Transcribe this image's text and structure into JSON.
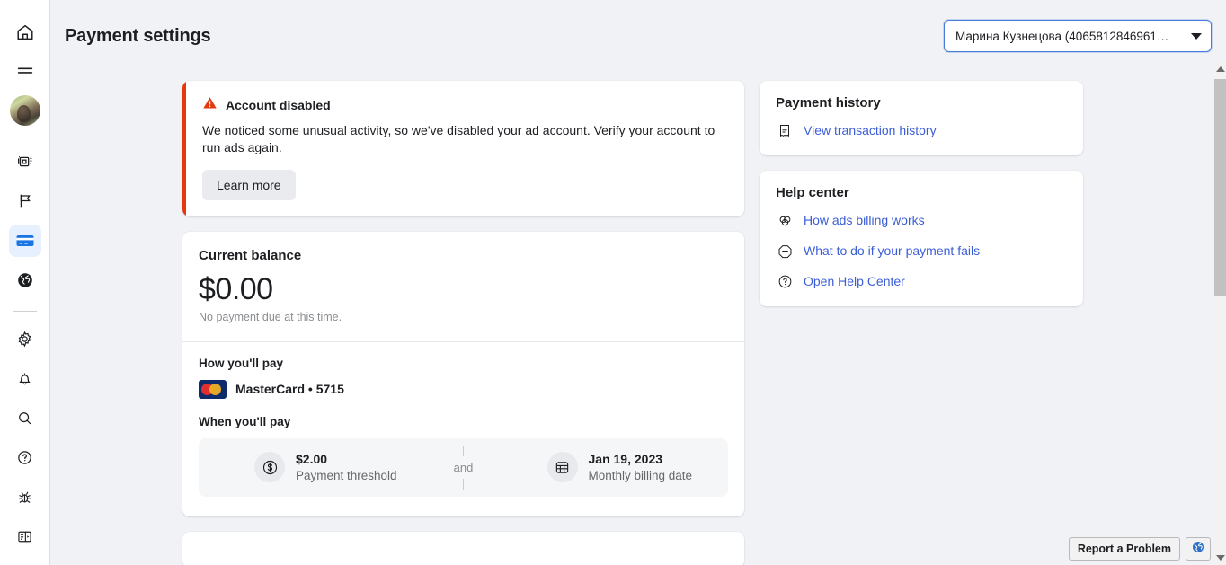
{
  "sidebar": {
    "items": [
      {
        "name": "home",
        "icon": "home-icon",
        "active": false
      },
      {
        "name": "menu",
        "icon": "hamburger-menu-icon",
        "active": false
      },
      {
        "name": "profile",
        "icon": "avatar",
        "active": false
      },
      {
        "name": "ads-manager",
        "icon": "copies-icon",
        "active": false
      },
      {
        "name": "campaigns",
        "icon": "flag-icon",
        "active": false
      },
      {
        "name": "billing",
        "icon": "credit-card-icon",
        "active": true
      },
      {
        "name": "globe",
        "icon": "globe-icon",
        "active": false
      },
      {
        "name": "settings",
        "icon": "gear-icon",
        "active": false
      },
      {
        "name": "notifications",
        "icon": "bell-icon",
        "active": false
      },
      {
        "name": "search",
        "icon": "search-icon",
        "active": false
      },
      {
        "name": "help",
        "icon": "question-circle-icon",
        "active": false
      },
      {
        "name": "bug-report",
        "icon": "bug-icon",
        "active": false
      },
      {
        "name": "panel-toggle",
        "icon": "panel-layout-icon",
        "active": false
      }
    ]
  },
  "header": {
    "title": "Payment settings",
    "account_selector": {
      "value": "Марина Кузнецова (4065812846961…",
      "icon": "chevron-down-icon"
    }
  },
  "alert": {
    "icon": "warning-triangle-icon",
    "title": "Account disabled",
    "body": "We noticed some unusual activity, so we've disabled your ad account. Verify your account to run ads again.",
    "button_label": "Learn more",
    "accent_color": "#e4390d"
  },
  "balance": {
    "title": "Current balance",
    "amount": "$0.00",
    "note": "No payment due at this time.",
    "how_label": "How you'll pay",
    "payment_method": {
      "icon": "mastercard-logo",
      "label": "MasterCard • 5715"
    },
    "when_label": "When you'll pay",
    "threshold": {
      "icon": "dollar-circle-icon",
      "value": "$2.00",
      "label": "Payment threshold"
    },
    "conjunction": "and",
    "billing_date": {
      "icon": "calendar-icon",
      "value": "Jan 19, 2023",
      "label": "Monthly billing date"
    }
  },
  "payment_history": {
    "title": "Payment history",
    "links": [
      {
        "icon": "receipt-icon",
        "label": "View transaction history"
      }
    ]
  },
  "help_center": {
    "title": "Help center",
    "links": [
      {
        "icon": "billing-rings-icon",
        "label": "How ads billing works"
      },
      {
        "icon": "minus-octagon-icon",
        "label": "What to do if your payment fails"
      },
      {
        "icon": "question-circle-icon",
        "label": "Open Help Center"
      }
    ]
  },
  "footer": {
    "report_label": "Report a Problem",
    "globe_icon": "globe-icon"
  },
  "scrollbar": {
    "up_icon": "arrow-up-icon",
    "down_icon": "arrow-down-icon"
  },
  "colors": {
    "link": "#3b5ed7",
    "accent_active": "#1b74e4",
    "alert": "#e4390d",
    "page_bg": "#f0f2f5"
  }
}
